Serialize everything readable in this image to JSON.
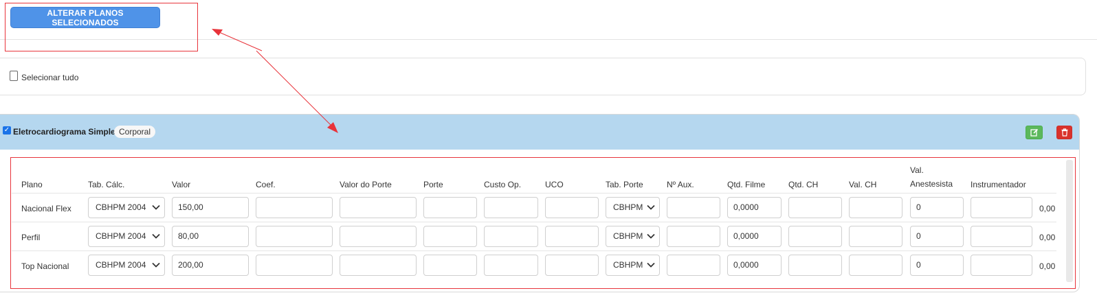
{
  "toolbar": {
    "alterar_label": "ALTERAR PLANOS SELECIONADOS"
  },
  "select_all": {
    "label": "Selecionar tudo"
  },
  "procedure": {
    "checked": true,
    "title": "Eletrocardiograma Simples",
    "badge": "Corporal"
  },
  "table": {
    "headers": {
      "plano": "Plano",
      "tab_calc": "Tab. Cálc.",
      "valor": "Valor",
      "coef": "Coef.",
      "valor_porte": "Valor do Porte",
      "porte": "Porte",
      "custo_op": "Custo Op.",
      "uco": "UCO",
      "tab_porte": "Tab. Porte",
      "n_aux": "Nº Aux.",
      "qtd_filme": "Qtd. Filme",
      "qtd_ch": "Qtd. CH",
      "val_ch": "Val. CH",
      "val_anest_1": "Val.",
      "val_anest_2": "Anestesista",
      "instrumentador": "Instrumentador"
    },
    "rows": [
      {
        "plano": "Nacional Flex",
        "tab_calc": "CBHPM 2004",
        "valor": "150,00",
        "coef": "",
        "valor_porte": "",
        "porte": "",
        "custo_op": "",
        "uco": "",
        "tab_porte": "CBHPM",
        "n_aux": "",
        "qtd_filme": "0,0000",
        "qtd_ch": "",
        "val_ch": "",
        "val_anestesista": "0",
        "instrumentador": "",
        "total": "0,00"
      },
      {
        "plano": "Perfil",
        "tab_calc": "CBHPM 2004",
        "valor": "80,00",
        "coef": "",
        "valor_porte": "",
        "porte": "",
        "custo_op": "",
        "uco": "",
        "tab_porte": "CBHPM",
        "n_aux": "",
        "qtd_filme": "0,0000",
        "qtd_ch": "",
        "val_ch": "",
        "val_anestesista": "0",
        "instrumentador": "",
        "total": "0,00"
      },
      {
        "plano": "Top Nacional",
        "tab_calc": "CBHPM 2004",
        "valor": "200,00",
        "coef": "",
        "valor_porte": "",
        "porte": "",
        "custo_op": "",
        "uco": "",
        "tab_porte": "CBHPM",
        "n_aux": "",
        "qtd_filme": "0,0000",
        "qtd_ch": "",
        "val_ch": "",
        "val_anestesista": "0",
        "instrumentador": "",
        "total": "0,00"
      }
    ]
  },
  "icons": {
    "edit": "edit-icon",
    "delete": "trash-icon",
    "chevron": "chevron-down-icon"
  },
  "colors": {
    "primary_button": "#4f93e8",
    "header_band": "#b5d7ef",
    "edit_button": "#5cb85c",
    "delete_button": "#d9322b",
    "annotation": "#e8333a"
  }
}
